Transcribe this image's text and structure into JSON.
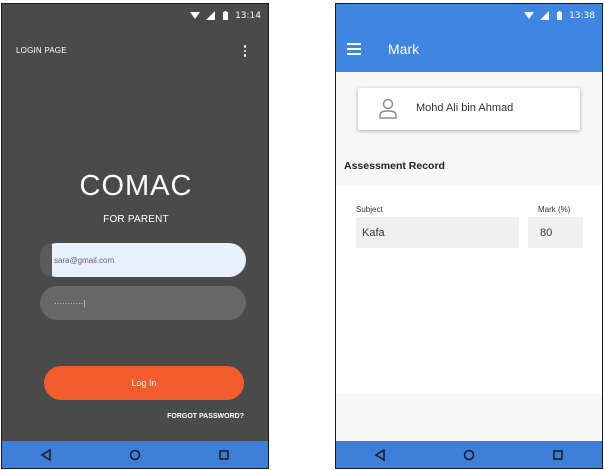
{
  "left_phone": {
    "status_time": "13:14",
    "toolbar_title": "LOGIN PAGE",
    "brand": "COMAC",
    "subtitle": "FOR PARENT",
    "email_value": "sara@gmail.com",
    "password_mask": "···········|",
    "login_label": "Log In",
    "forgot_label": "FORGOT PASSWORD?"
  },
  "right_phone": {
    "status_time": "13:38",
    "appbar_title": "Mark",
    "student_name": "Mohd Ali bin Ahmad",
    "section_heading": "Assessment Record",
    "table": {
      "columns": [
        "Subject",
        "Mark (%)"
      ],
      "rows": [
        {
          "subject": "Kafa",
          "mark": "80"
        }
      ]
    }
  },
  "colors": {
    "login_bg": "#4a4a4a",
    "accent_orange": "#f25b2b",
    "app_blue": "#3f86e2",
    "nav_blue": "#3d7fd8"
  },
  "icons": {
    "status": [
      "wifi-icon",
      "signal-icon",
      "battery-icon"
    ],
    "nav": [
      "back-icon",
      "home-icon",
      "recents-icon"
    ],
    "menu": "overflow-menu-icon",
    "drawer": "hamburger-icon",
    "person": "person-icon"
  }
}
